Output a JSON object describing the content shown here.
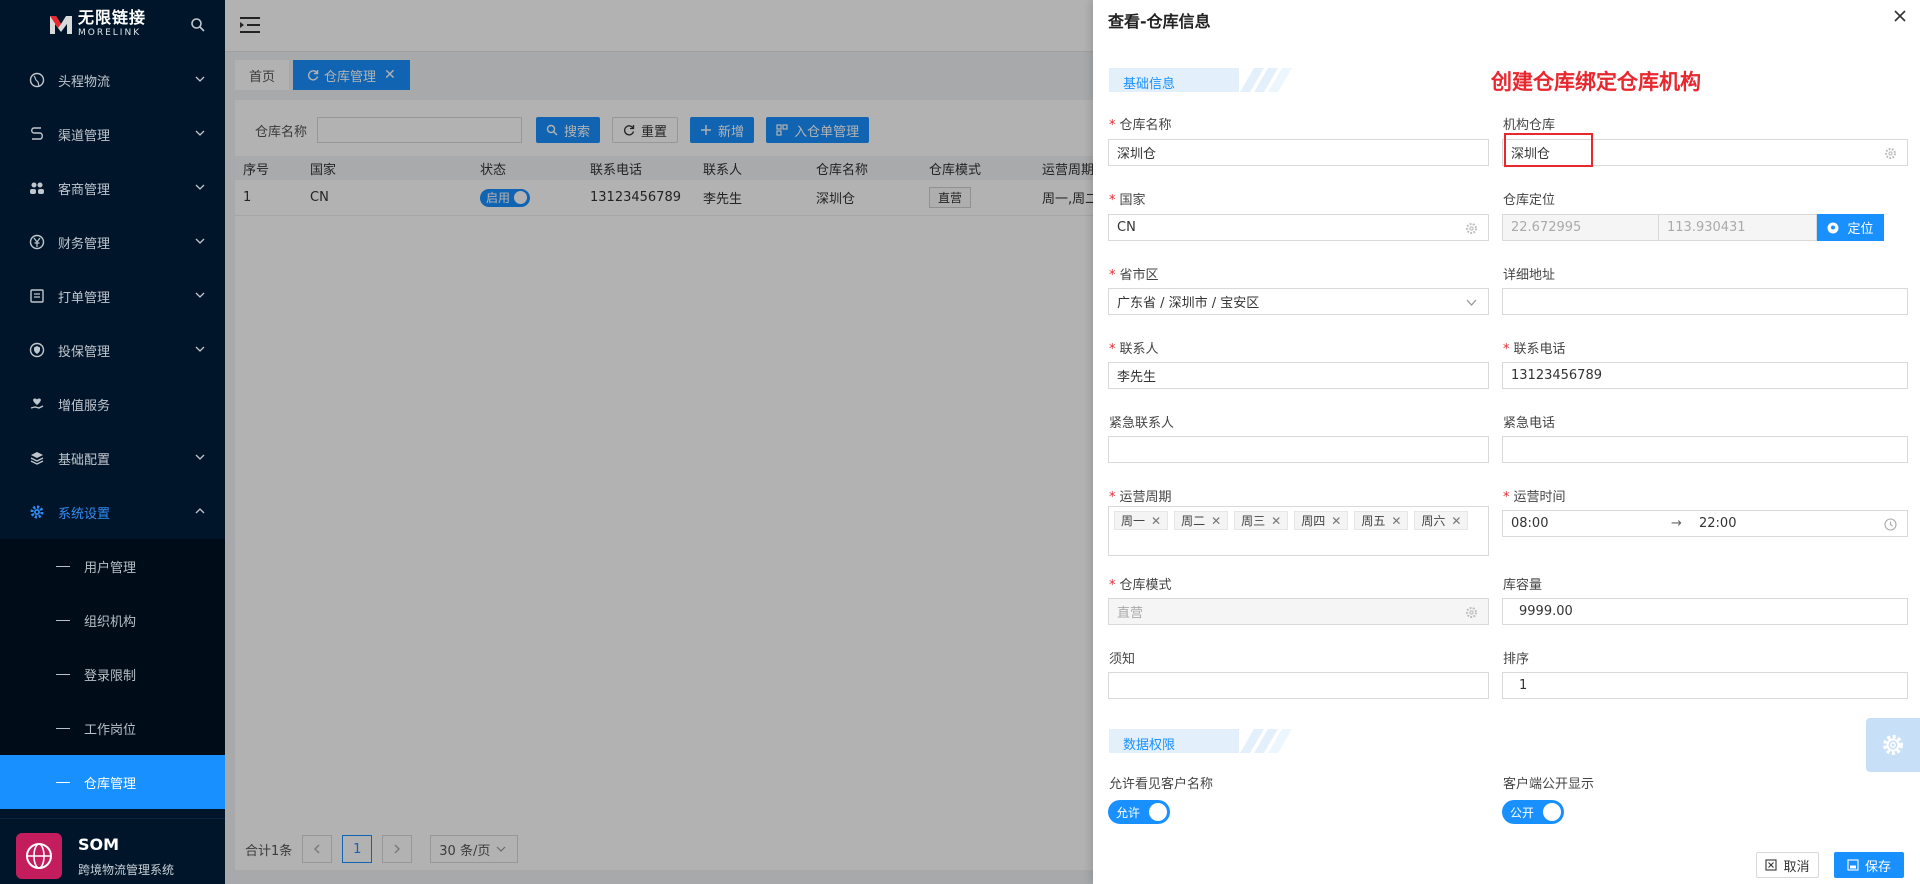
{
  "brand": {
    "name_cn": "无限链接",
    "name_en": "MORELINK"
  },
  "sidebar": {
    "items": [
      {
        "label": "头程物流",
        "icon": "globe-icon",
        "has_children": true
      },
      {
        "label": "渠道管理",
        "icon": "route-icon",
        "has_children": true
      },
      {
        "label": "客商管理",
        "icon": "users-icon",
        "has_children": true
      },
      {
        "label": "财务管理",
        "icon": "yen-icon",
        "has_children": true
      },
      {
        "label": "打单管理",
        "icon": "printer-icon",
        "has_children": true
      },
      {
        "label": "投保管理",
        "icon": "shield-icon",
        "has_children": true
      },
      {
        "label": "增值服务",
        "icon": "heart-hand-icon",
        "has_children": false
      },
      {
        "label": "基础配置",
        "icon": "layers-icon",
        "has_children": true
      },
      {
        "label": "系统设置",
        "icon": "gear-icon",
        "has_children": true,
        "expanded": true
      }
    ],
    "submenu": [
      {
        "label": "用户管理"
      },
      {
        "label": "组织机构"
      },
      {
        "label": "登录限制"
      },
      {
        "label": "工作岗位"
      },
      {
        "label": "仓库管理",
        "selected": true
      }
    ],
    "footer": {
      "title": "SOM",
      "subtitle": "跨境物流管理系统"
    }
  },
  "tabs": [
    {
      "label": "首页",
      "active": false
    },
    {
      "label": "仓库管理",
      "active": true
    }
  ],
  "filter": {
    "label": "仓库名称",
    "value": "",
    "buttons": {
      "search": "搜索",
      "reset": "重置",
      "add": "新增",
      "inbound": "入仓单管理"
    }
  },
  "table": {
    "columns": [
      "序号",
      "国家",
      "状态",
      "联系电话",
      "联系人",
      "仓库名称",
      "仓库模式",
      "运营周期"
    ],
    "rows": [
      {
        "index": "1",
        "country": "CN",
        "status": "启用",
        "phone": "13123456789",
        "contact": "李先生",
        "name": "深圳仓",
        "mode": "直营",
        "cycle": "周一,周二"
      }
    ]
  },
  "pager": {
    "total": "合计1条",
    "current": "1",
    "page_size": "30 条/页"
  },
  "drawer": {
    "title": "查看-仓库信息",
    "annotation": "创建仓库绑定仓库机构",
    "section_basic": "基础信息",
    "section_permission": "数据权限",
    "fields": {
      "warehouse_name": {
        "label": "仓库名称",
        "required": true,
        "value": "深圳仓"
      },
      "org_warehouse": {
        "label": "机构仓库",
        "required": false,
        "value": "深圳仓"
      },
      "country": {
        "label": "国家",
        "required": true,
        "value": "CN"
      },
      "location": {
        "label": "仓库定位",
        "required": false,
        "lat": "22.672995",
        "lng": "113.930431",
        "button": "定位"
      },
      "region": {
        "label": "省市区",
        "required": true,
        "value": "广东省 / 深圳市 / 宝安区"
      },
      "address": {
        "label": "详细地址",
        "required": false,
        "value": ""
      },
      "contact": {
        "label": "联系人",
        "required": true,
        "value": "李先生"
      },
      "phone": {
        "label": "联系电话",
        "required": true,
        "value": "13123456789"
      },
      "emergency_contact": {
        "label": "紧急联系人",
        "required": false,
        "value": ""
      },
      "emergency_phone": {
        "label": "紧急电话",
        "required": false,
        "value": ""
      },
      "cycle": {
        "label": "运营周期",
        "required": true,
        "tags": [
          "周一",
          "周二",
          "周三",
          "周四",
          "周五",
          "周六"
        ]
      },
      "hours": {
        "label": "运营时间",
        "required": true,
        "start": "08:00",
        "arrow": "→",
        "end": "22:00"
      },
      "mode": {
        "label": "仓库模式",
        "required": true,
        "value": "直营"
      },
      "capacity": {
        "label": "库容量",
        "required": false,
        "value": "9999.00"
      },
      "notice": {
        "label": "须知",
        "required": false,
        "value": ""
      },
      "sort": {
        "label": "排序",
        "required": false,
        "value": "1"
      }
    },
    "permissions": {
      "show_customer": {
        "label": "允许看见客户名称",
        "switch_text": "允许",
        "on": true
      },
      "public_display": {
        "label": "客户端公开显示",
        "switch_text": "公开",
        "on": true
      }
    },
    "footer": {
      "cancel": "取消",
      "save": "保存"
    }
  },
  "colors": {
    "primary": "#1890ff",
    "sidebar_bg": "#001529",
    "annotation_red": "#e8272e"
  }
}
